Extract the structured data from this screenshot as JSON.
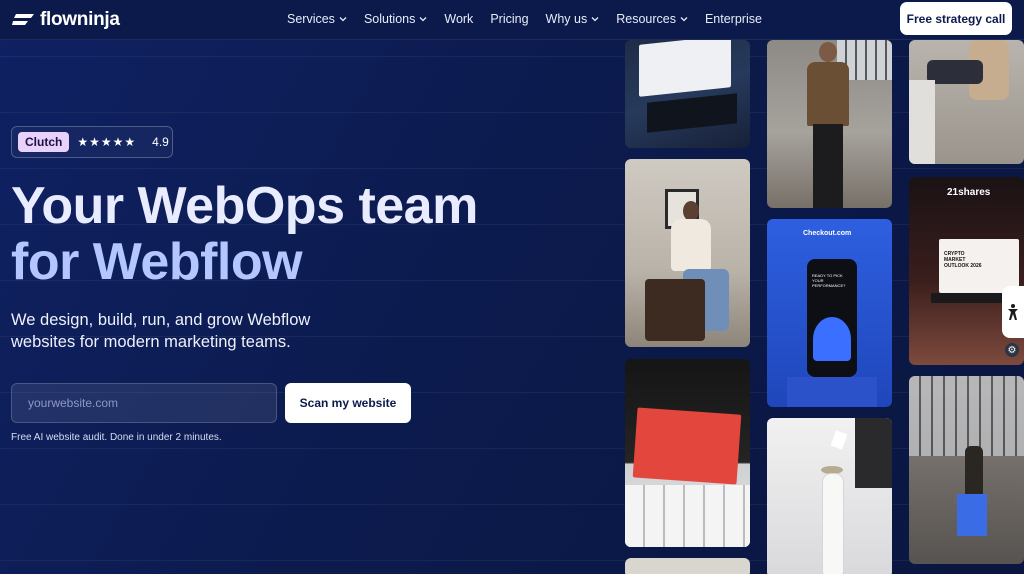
{
  "brand": {
    "name": "flowninja"
  },
  "nav": {
    "items": [
      {
        "label": "Services",
        "dropdown": true
      },
      {
        "label": "Solutions",
        "dropdown": true
      },
      {
        "label": "Work",
        "dropdown": false
      },
      {
        "label": "Pricing",
        "dropdown": false
      },
      {
        "label": "Why us",
        "dropdown": true
      },
      {
        "label": "Resources",
        "dropdown": true
      },
      {
        "label": "Enterprise",
        "dropdown": false
      }
    ],
    "cta_label": "Free strategy call"
  },
  "hero": {
    "badge": {
      "brand": "Clutch",
      "stars": "★★★★★",
      "rating": "4.9"
    },
    "headline_line1": "Your WebOps team",
    "headline_line2": "for Webflow",
    "subheadline": "We design, build, run, and grow Webflow websites for modern marketing teams.",
    "input_placeholder": "yourwebsite.com",
    "scan_button_label": "Scan my website",
    "note": "Free AI website audit. Done in under 2 minutes."
  },
  "gallery": {
    "checkout_label": "Checkout.com",
    "shares_label": "21shares",
    "crypto_label": "CRYPTO MARKET OUTLOOK 2026",
    "phone_label": "READY TO PICK YOUR PERFORMANCE?"
  },
  "colors": {
    "background": "#0d1d52",
    "nav_bg": "#0b1a4a",
    "accent_text": "#b3c6ff",
    "clutch_badge": "#e8d2f9",
    "button_bg": "#ffffff"
  }
}
